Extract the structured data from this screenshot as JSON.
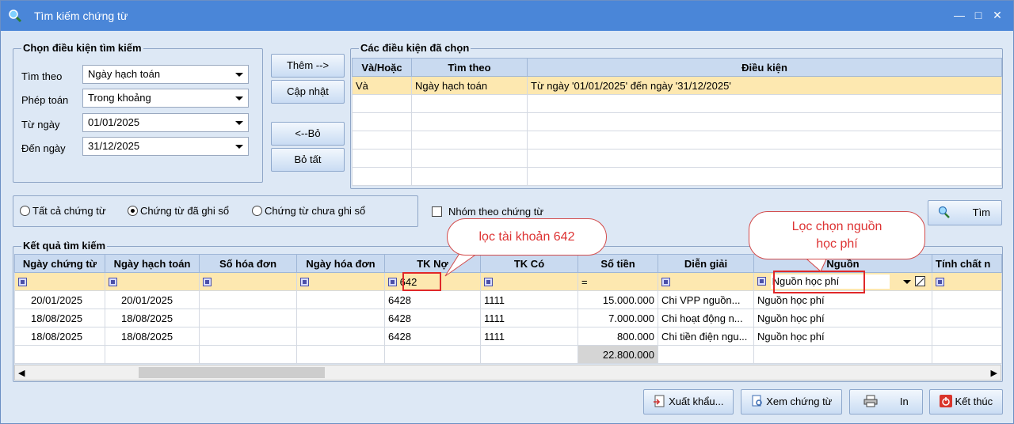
{
  "window": {
    "title": "Tìm kiếm chứng từ"
  },
  "criteria": {
    "title": "Chọn điều kiện tìm kiếm",
    "search_by_label": "Tìm theo",
    "search_by_value": "Ngày hạch toán",
    "operator_label": "Phép toán",
    "operator_value": "Trong khoảng",
    "from_label": "Từ ngày",
    "from_value": "01/01/2025",
    "to_label": "Đến ngày",
    "to_value": "31/12/2025"
  },
  "buttons": {
    "add": "Thêm -->",
    "update": "Cập nhật",
    "remove": "<--Bỏ",
    "remove_all": "Bỏ tất",
    "search": "Tìm",
    "export": "Xuất khẩu...",
    "view": "Xem chứng từ",
    "print": "In",
    "close": "Kết thúc"
  },
  "selected": {
    "title": "Các điều kiện đã chọn",
    "headers": [
      "Và/Hoặc",
      "Tìm theo",
      "Điều kiện"
    ],
    "rows": [
      [
        "Và",
        "Ngày hạch toán",
        "Từ ngày '01/01/2025' đến ngày '31/12/2025'"
      ]
    ]
  },
  "radios": {
    "all": "Tất cả chứng từ",
    "posted": "Chứng từ đã ghi sổ",
    "unposted": "Chứng từ chưa ghi sổ",
    "selected": "posted"
  },
  "group_by_doc": "Nhóm theo chứng từ",
  "results": {
    "title": "Kết quả tìm kiếm",
    "headers": [
      "Ngày chứng từ",
      "Ngày hạch toán",
      "Số hóa đơn",
      "Ngày hóa đơn",
      "TK Nợ",
      "TK Có",
      "Số tiền",
      "Diễn giải",
      "Nguồn",
      "Tính chất n"
    ],
    "filter": {
      "debit": "642",
      "amount_op": "=",
      "source": "Nguồn học phí"
    },
    "rows": [
      [
        "20/01/2025",
        "20/01/2025",
        "",
        "",
        "6428",
        "1111",
        "15.000.000",
        "Chi VPP nguồn...",
        "Nguồn học phí",
        ""
      ],
      [
        "18/08/2025",
        "18/08/2025",
        "",
        "",
        "6428",
        "1111",
        "7.000.000",
        "Chi hoạt động n...",
        "Nguồn học phí",
        ""
      ],
      [
        "18/08/2025",
        "18/08/2025",
        "",
        "",
        "6428",
        "1111",
        "800.000",
        "Chi tiền điện ngu...",
        "Nguồn học phí",
        ""
      ]
    ],
    "total": "22.800.000"
  },
  "annotations": {
    "account": "lọc tài khoản 642",
    "source_line1": "Lọc chọn nguồn",
    "source_line2": "học phí"
  }
}
